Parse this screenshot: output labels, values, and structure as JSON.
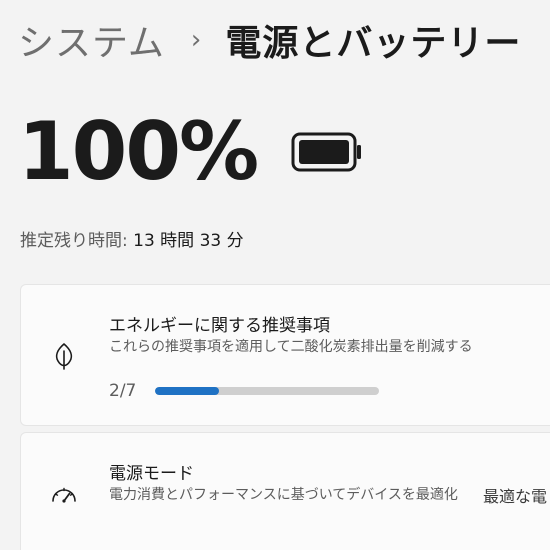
{
  "breadcrumb": {
    "parent": "システム",
    "separator": "›",
    "current": "電源とバッテリー"
  },
  "battery": {
    "percent_label": "100%",
    "level": 1.0,
    "remaining_label": "推定残り時間:",
    "remaining_value": "13 時間 33 分"
  },
  "energy_recommendations": {
    "icon": "leaf-icon",
    "title": "エネルギーに関する推奨事項",
    "description": "これらの推奨事項を適用して二酸化炭素排出量を削減する",
    "progress_label": "2/7",
    "progress_fraction": 0.2857,
    "accent_color": "#1f72c4"
  },
  "power_mode": {
    "icon": "gauge-icon",
    "title": "電源モード",
    "description": "電力消費とパフォーマンスに基づいてデバイスを最適化",
    "selected_value": "最適な電"
  }
}
